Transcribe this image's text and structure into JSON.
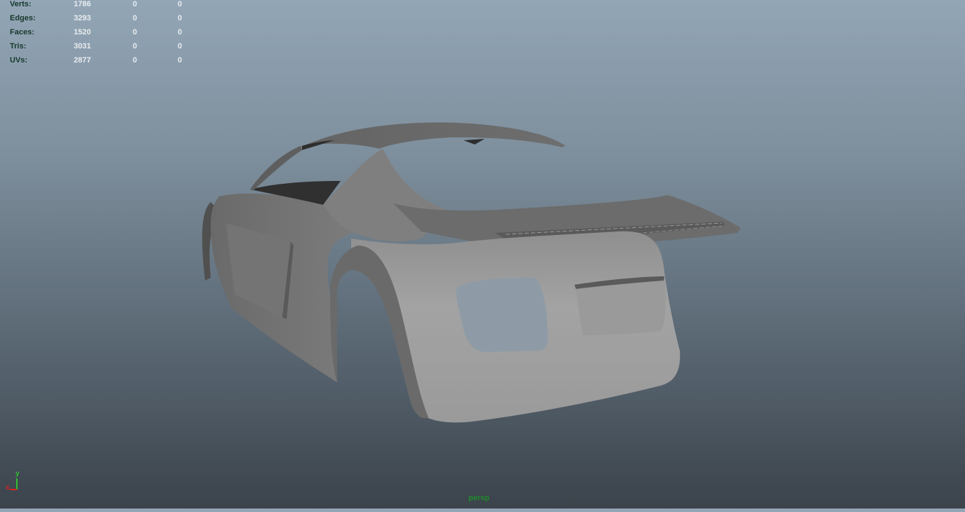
{
  "hud": {
    "rows": [
      {
        "label": "Verts:",
        "v1": "1786",
        "v2": "0",
        "v3": "0"
      },
      {
        "label": "Edges:",
        "v1": "3293",
        "v2": "0",
        "v3": "0"
      },
      {
        "label": "Faces:",
        "v1": "1520",
        "v2": "0",
        "v3": "0"
      },
      {
        "label": "Tris:",
        "v1": "3031",
        "v2": "0",
        "v3": "0"
      },
      {
        "label": "UVs:",
        "v1": "2877",
        "v2": "0",
        "v3": "0"
      }
    ]
  },
  "viewport": {
    "camera": "persp",
    "object": "car-body-mesh",
    "axis": {
      "y": "y",
      "x": "x"
    }
  },
  "colors": {
    "hud_label": "#16382a",
    "hud_value": "#e8ecef",
    "camera_label": "#1e8a2c",
    "axis_x": "#d62020",
    "axis_y": "#2fc02f"
  }
}
